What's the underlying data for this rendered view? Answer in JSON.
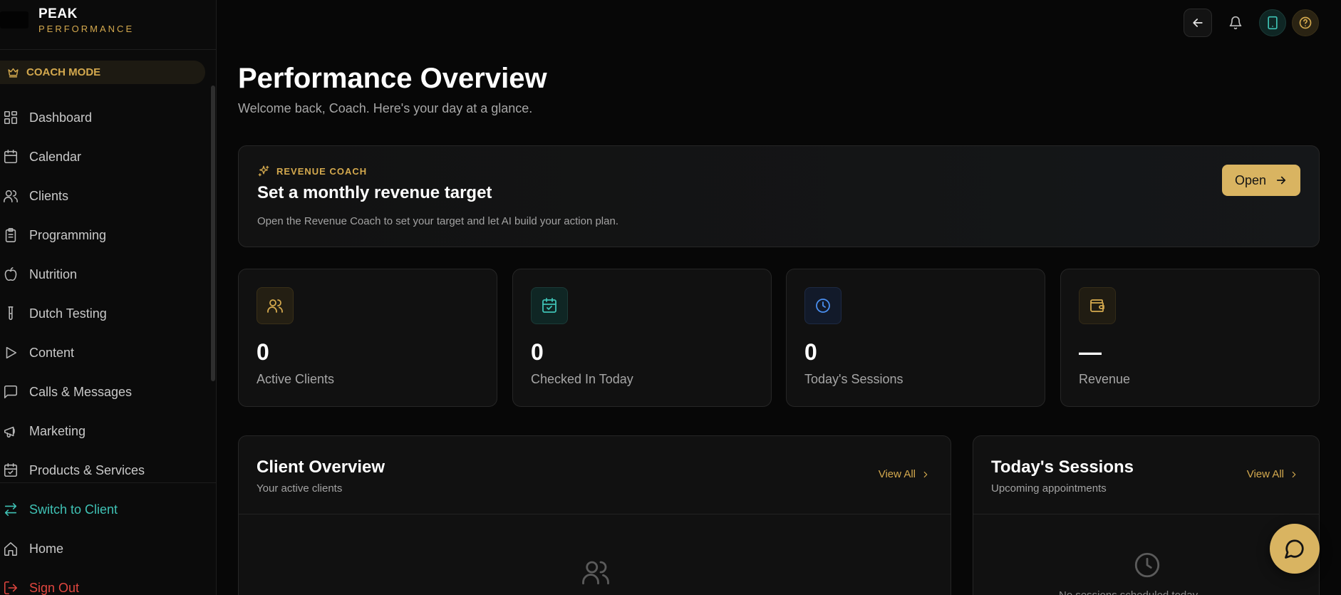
{
  "brand": {
    "name": "PEAK",
    "subtitle": "PERFORMANCE"
  },
  "coach_mode": {
    "label": "COACH MODE",
    "icon": "crown-icon"
  },
  "sidebar": {
    "items": [
      {
        "label": "Dashboard",
        "icon": "grid-icon"
      },
      {
        "label": "Calendar",
        "icon": "calendar-icon"
      },
      {
        "label": "Clients",
        "icon": "users-icon"
      },
      {
        "label": "Programming",
        "icon": "clipboard-icon"
      },
      {
        "label": "Nutrition",
        "icon": "apple-icon"
      },
      {
        "label": "Dutch Testing",
        "icon": "test-tube-icon"
      },
      {
        "label": "Content",
        "icon": "play-icon"
      },
      {
        "label": "Calls & Messages",
        "icon": "message-square-icon"
      },
      {
        "label": "Marketing",
        "icon": "megaphone-icon"
      },
      {
        "label": "Products & Services",
        "icon": "calendar-check-icon"
      }
    ],
    "bottom": [
      {
        "label": "Switch to Client",
        "icon": "arrows-switch-icon",
        "color": "#3fc2b5"
      },
      {
        "label": "Home",
        "icon": "home-icon"
      },
      {
        "label": "Sign Out",
        "icon": "log-out-icon",
        "color": "#e0463f"
      }
    ]
  },
  "topbar": {
    "icons": [
      "arrow-left-icon",
      "bell-icon",
      "tablet-icon",
      "help-circle-icon"
    ]
  },
  "header": {
    "title": "Performance Overview",
    "subtitle": "Welcome back, Coach. Here's your day at a glance."
  },
  "banner": {
    "kicker": "REVENUE COACH",
    "title": "Set a monthly revenue target",
    "description": "Open the Revenue Coach to set your target and let AI build your action plan.",
    "button": "Open"
  },
  "stats": [
    {
      "value": "0",
      "label": "Active Clients",
      "icon": "users-icon",
      "color": "#d4a94e"
    },
    {
      "value": "0",
      "label": "Checked In Today",
      "icon": "calendar-check-icon",
      "color": "#3fc2b5"
    },
    {
      "value": "0",
      "label": "Today's Sessions",
      "icon": "clock-icon",
      "color": "#4a8ff0"
    },
    {
      "value": "—",
      "label": "Revenue",
      "icon": "wallet-icon",
      "color": "#d4a94e"
    }
  ],
  "client_overview": {
    "title": "Client Overview",
    "subtitle": "Your active clients",
    "link": "View All"
  },
  "todays_sessions": {
    "title": "Today's Sessions",
    "subtitle": "Upcoming appointments",
    "link": "View All",
    "empty": "No sessions scheduled today"
  },
  "colors": {
    "accent": "#d9b461",
    "teal": "#3fc2b5",
    "danger": "#e0463f",
    "background": "#070707"
  }
}
